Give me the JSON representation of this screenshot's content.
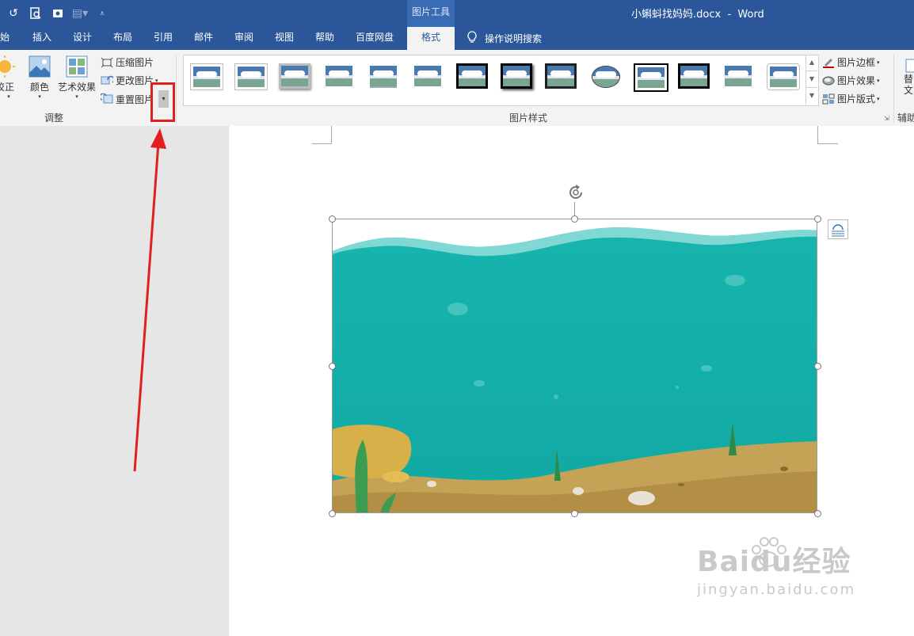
{
  "title_bar": {
    "doc_title": "小蝌蚪找妈妈.docx  -  Word",
    "tool_tab_label": "图片工具",
    "bg_color": "#2b579a"
  },
  "tabs": [
    {
      "label": "开始",
      "visible_text": "始"
    },
    {
      "label": "插入"
    },
    {
      "label": "设计"
    },
    {
      "label": "布局"
    },
    {
      "label": "引用"
    },
    {
      "label": "邮件"
    },
    {
      "label": "审阅"
    },
    {
      "label": "视图"
    },
    {
      "label": "帮助"
    },
    {
      "label": "百度网盘"
    },
    {
      "label": "格式",
      "active": true
    }
  ],
  "tell_me": "操作说明搜索",
  "ribbon": {
    "adjust": {
      "group_label": "调整",
      "correction": "校正",
      "color": "颜色",
      "artistic": "艺术效果",
      "compress": "压缩图片",
      "change": "更改图片",
      "reset": "重置图片"
    },
    "styles": {
      "group_label": "图片样式",
      "border": "图片边框",
      "effects": "图片效果",
      "layout": "图片版式"
    },
    "accessibility": {
      "group_label": "辅助",
      "button_text": "替\n文"
    }
  },
  "watermark": {
    "logo": "Baidu经验",
    "url": "jingyan.baidu.com"
  },
  "colors": {
    "accent": "#2b579a",
    "highlight": "#e0201e",
    "water": "#1ab3ad",
    "sand": "#c4a356"
  },
  "icons": [
    "undo-icon",
    "print-preview-icon",
    "save-icon",
    "format-painter-icon",
    "customize-qat-icon",
    "lightbulb-icon",
    "correction-icon",
    "color-icon",
    "artistic-effects-icon",
    "compress-icon",
    "change-picture-icon",
    "reset-picture-icon",
    "dropdown-arrow-icon",
    "picture-border-icon",
    "picture-effects-icon",
    "picture-layout-icon",
    "layout-options-icon",
    "rotate-handle-icon"
  ]
}
